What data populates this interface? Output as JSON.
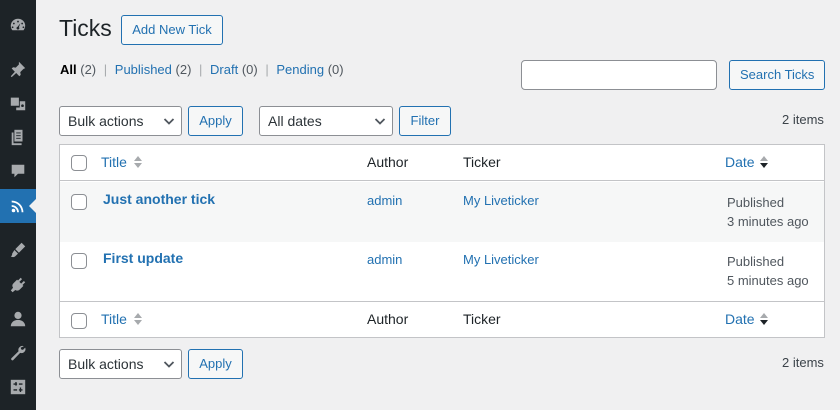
{
  "sidebar": {
    "items": [
      {
        "icon": "dashboard-icon"
      },
      {
        "icon": "pin-icon"
      },
      {
        "icon": "media-icon"
      },
      {
        "icon": "pages-icon"
      },
      {
        "icon": "comments-icon"
      },
      {
        "icon": "rss-icon",
        "active": true
      },
      {
        "icon": "appearance-icon"
      },
      {
        "icon": "plugins-icon"
      },
      {
        "icon": "users-icon"
      },
      {
        "icon": "tools-icon"
      },
      {
        "icon": "settings-icon"
      }
    ],
    "colors": {
      "bg": "#1d2327",
      "active": "#2271b1",
      "icon": "#a7aaad"
    }
  },
  "header": {
    "title": "Ticks",
    "add_new_label": "Add New Tick"
  },
  "filters": {
    "all": {
      "label": "All",
      "count": "(2)"
    },
    "published": {
      "label": "Published",
      "count": "(2)"
    },
    "draft": {
      "label": "Draft",
      "count": "(0)"
    },
    "pending": {
      "label": "Pending",
      "count": "(0)"
    },
    "separator": "|"
  },
  "search": {
    "value": "",
    "button_label": "Search Ticks"
  },
  "tablenav_top": {
    "bulk_actions": "Bulk actions",
    "apply_label": "Apply",
    "dates": "All dates",
    "filter_label": "Filter",
    "items_count": "2 items"
  },
  "tablenav_bottom": {
    "bulk_actions": "Bulk actions",
    "apply_label": "Apply",
    "items_count": "2 items"
  },
  "table": {
    "columns": {
      "title": "Title",
      "author": "Author",
      "ticker": "Ticker",
      "date": "Date"
    },
    "rows": [
      {
        "title": "Just another tick",
        "author": "admin",
        "ticker": "My Liveticker",
        "status": "Published",
        "time": "3 minutes ago"
      },
      {
        "title": "First update",
        "author": "admin",
        "ticker": "My Liveticker",
        "status": "Published",
        "time": "5 minutes ago"
      }
    ]
  },
  "colors": {
    "accent": "#2271b1",
    "bg": "#f0f0f1",
    "text": "#3c434a"
  }
}
